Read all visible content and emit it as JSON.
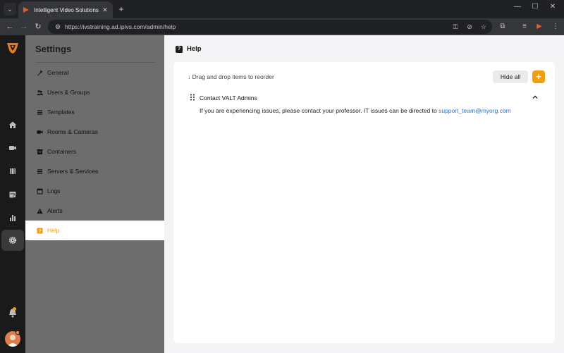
{
  "browser": {
    "tab_title": "Intelligent Video Solutions",
    "url": "https://ivstraining.ad.ipivs.com/admin/help"
  },
  "settings": {
    "title": "Settings",
    "items": [
      {
        "label": "General",
        "icon": "wrench-icon"
      },
      {
        "label": "Users & Groups",
        "icon": "users-icon"
      },
      {
        "label": "Templates",
        "icon": "list-icon"
      },
      {
        "label": "Rooms & Cameras",
        "icon": "camera-icon"
      },
      {
        "label": "Containers",
        "icon": "archive-icon"
      },
      {
        "label": "Servers & Services",
        "icon": "server-icon"
      },
      {
        "label": "Logs",
        "icon": "calendar-icon"
      },
      {
        "label": "Alerts",
        "icon": "warning-icon"
      },
      {
        "label": "Help",
        "icon": "help-icon",
        "active": true
      }
    ]
  },
  "main": {
    "title": "Help",
    "reorder_hint": "↓ Drag and drop items to reorder",
    "hide_all_label": "Hide all",
    "add_label": "+",
    "help_item": {
      "title": "Contact VALT Admins",
      "body_text": "If you are experiencing issues, please contact your professor. IT issues can be directed to ",
      "body_link": "support_team@myorg.com"
    }
  },
  "colors": {
    "accent": "#f59e0b",
    "link": "#1a73e8",
    "rail_bg": "#1a1a1a",
    "settings_bg": "#6d6d6d"
  }
}
